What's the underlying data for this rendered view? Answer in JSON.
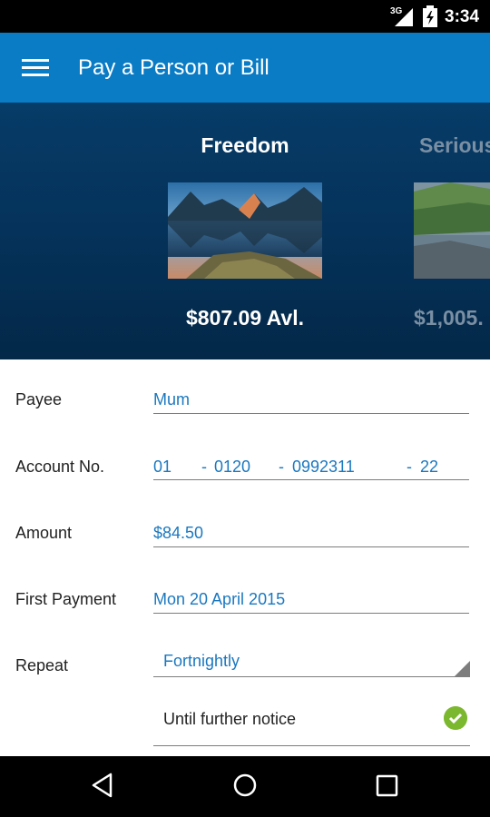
{
  "status_bar": {
    "network": "3G",
    "time": "3:34"
  },
  "app_bar": {
    "title": "Pay a Person or Bill"
  },
  "accounts": [
    {
      "name": "Freedom",
      "balance": "$807.09 Avl."
    },
    {
      "name": "Serious",
      "balance": "$1,005."
    }
  ],
  "form": {
    "payee": {
      "label": "Payee",
      "value": "Mum"
    },
    "account_no": {
      "label": "Account No.",
      "bank": "01",
      "branch": "0120",
      "account": "0992311",
      "suffix": "22",
      "separator": "-"
    },
    "amount": {
      "label": "Amount",
      "value": "$84.50"
    },
    "first_payment": {
      "label": "First Payment",
      "value": "Mon 20 April 2015"
    },
    "repeat": {
      "label": "Repeat",
      "value": "Fortnightly"
    },
    "until": {
      "value": "Until further notice"
    }
  },
  "colors": {
    "app_bar": "#0a7bc5",
    "field_text": "#1a78c0",
    "check": "#7cb82f"
  }
}
